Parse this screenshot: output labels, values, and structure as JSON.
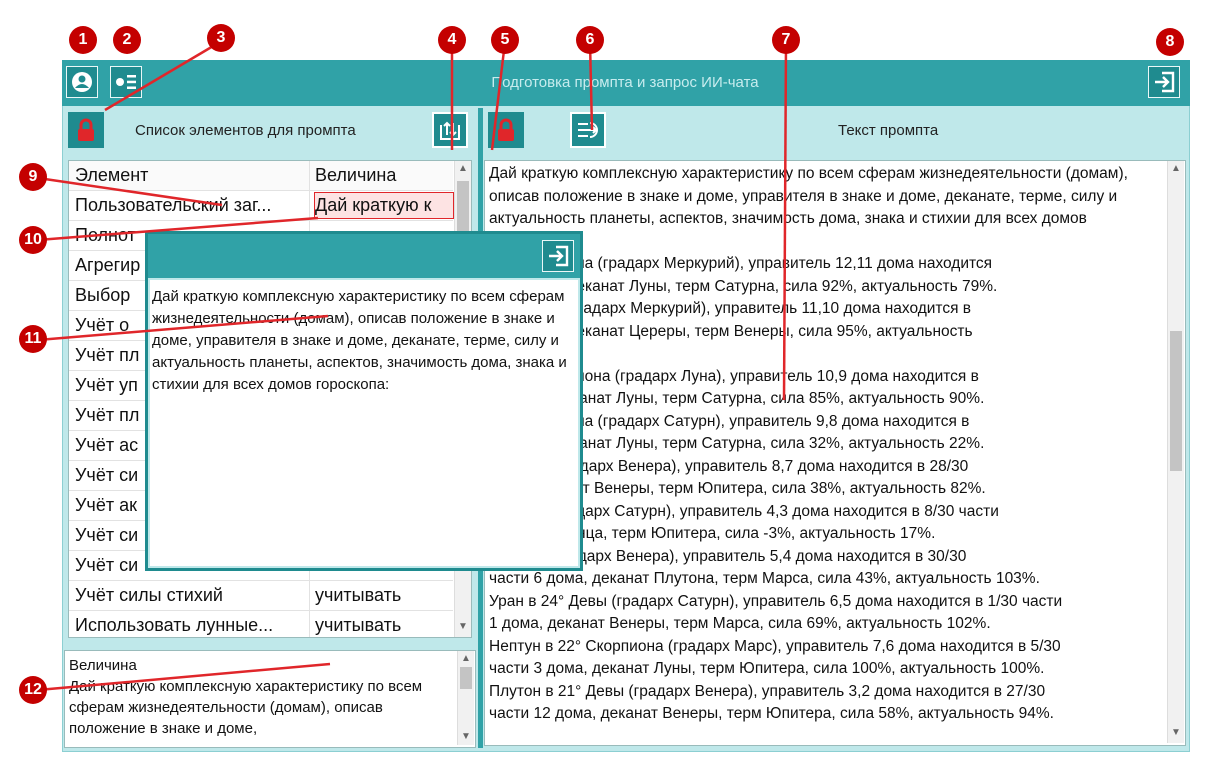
{
  "window": {
    "title": "Подготовка промпта и запрос ИИ-чата"
  },
  "left_panel": {
    "header": "Список элементов для промпта"
  },
  "right_panel": {
    "header": "Текст промпта"
  },
  "table": {
    "columns": [
      "Элемент",
      "Величина"
    ],
    "rows": [
      {
        "element": "Пользовательский заг...",
        "value": "Дай краткую к"
      },
      {
        "element": "Полнот",
        "value": ""
      },
      {
        "element": "Агрегир",
        "value": ""
      },
      {
        "element": "Выбор",
        "value": ""
      },
      {
        "element": "Учёт о",
        "value": ""
      },
      {
        "element": "Учёт пл",
        "value": ""
      },
      {
        "element": "Учёт уп",
        "value": ""
      },
      {
        "element": "Учёт пл",
        "value": ""
      },
      {
        "element": "Учёт ас",
        "value": ""
      },
      {
        "element": "Учёт си",
        "value": ""
      },
      {
        "element": "Учёт ак",
        "value": ""
      },
      {
        "element": "Учёт си",
        "value": ""
      },
      {
        "element": "Учёт си",
        "value": ""
      },
      {
        "element": "Учёт силы стихий",
        "value": "учитывать"
      },
      {
        "element": "Использовать лунные...",
        "value": "учитывать"
      }
    ]
  },
  "detail": {
    "label": "Величина",
    "text": "Дай краткую комплексную характеристику по всем сферам жизнедеятельности (домам), описав положение в знаке и доме,"
  },
  "prompt_text": "Дай краткую комплексную характеристику по всем сферам жизнедеятельности (домам), описав положение в знаке и доме, управителя в знаке и доме, деканате, терме, силу и актуальность планеты, аспектов, значимость дома, знака и стихии для всех домов гороскопа:\n…° Скорпиона (градарх Меркурий), управитель 12,11 дома находится\n… 3 дома, деканат Луны, терм Сатурна, сила 92%, актуальность 79%.\n…озерога (градарх Меркурий), управитель 11,10 дома находится в\n… 4 дома, деканат Цереры, терм Венеры, сила 95%, актуальность\n\n…26° Скорпиона (градарх Луна), управитель 10,9 дома находится в\n… дома, деканат Луны, терм Сатурна, сила 85%, актуальность 90%.\n…° Скорпиона (градарх Сатурн), управитель 9,8 дома находится в\n… дома, деканат Луны, терм Сатурна, сила 32%, актуальность 22%.\n… Девы (градарх Венера), управитель 8,7 дома находится в 28/30\n…ма, деканат Венеры, терм Юпитера, сила 38%, актуальность 82%.\n… Льва (градарх Сатурн), управитель 4,3 дома находится в 8/30 части\n…канат Солнца, терм Юпитера, сила -3%, актуальность 17%.\n…° Рыб (градарх Венера), управитель 5,4 дома находится в 30/30\nчасти 6 дома, деканат Плутона, терм Марса, сила 43%, актуальность 103%.\nУран в 24° Девы (градарх Сатурн), управитель 6,5 дома находится в 1/30 части\n1 дома, деканат Венеры, терм Марса, сила 69%, актуальность 102%.\nНептун в 22° Скорпиона (градарх Марс), управитель 7,6 дома находится в 5/30\nчасти 3 дома, деканат Луны, терм Юпитера, сила 100%, актуальность 100%.\nПлутон в 21° Девы (градарх Венера), управитель 3,2 дома находится в 27/30\nчасти 12 дома, деканат Венеры, терм Юпитера, сила 58%, актуальность 94%.",
  "popup": {
    "text": "Дай краткую комплексную характеристику по всем сферам жизнедеятельности (домам), описав положение в знаке и доме, управителя в знаке и доме, деканате, терме, силу и актуальность планеты, аспектов, значимость дома, знака и стихии для всех домов гороскопа:"
  },
  "callouts": [
    "1",
    "2",
    "3",
    "4",
    "5",
    "6",
    "7",
    "8",
    "9",
    "10",
    "11",
    "12"
  ],
  "colors": {
    "accent": "#30a2a7",
    "panel": "#bfe8ea",
    "lock": "#e0262a",
    "callout": "#c40000"
  },
  "icons": [
    "user-icon",
    "list-icon",
    "exit-icon",
    "lock-icon",
    "sort-icon",
    "import-icon"
  ]
}
